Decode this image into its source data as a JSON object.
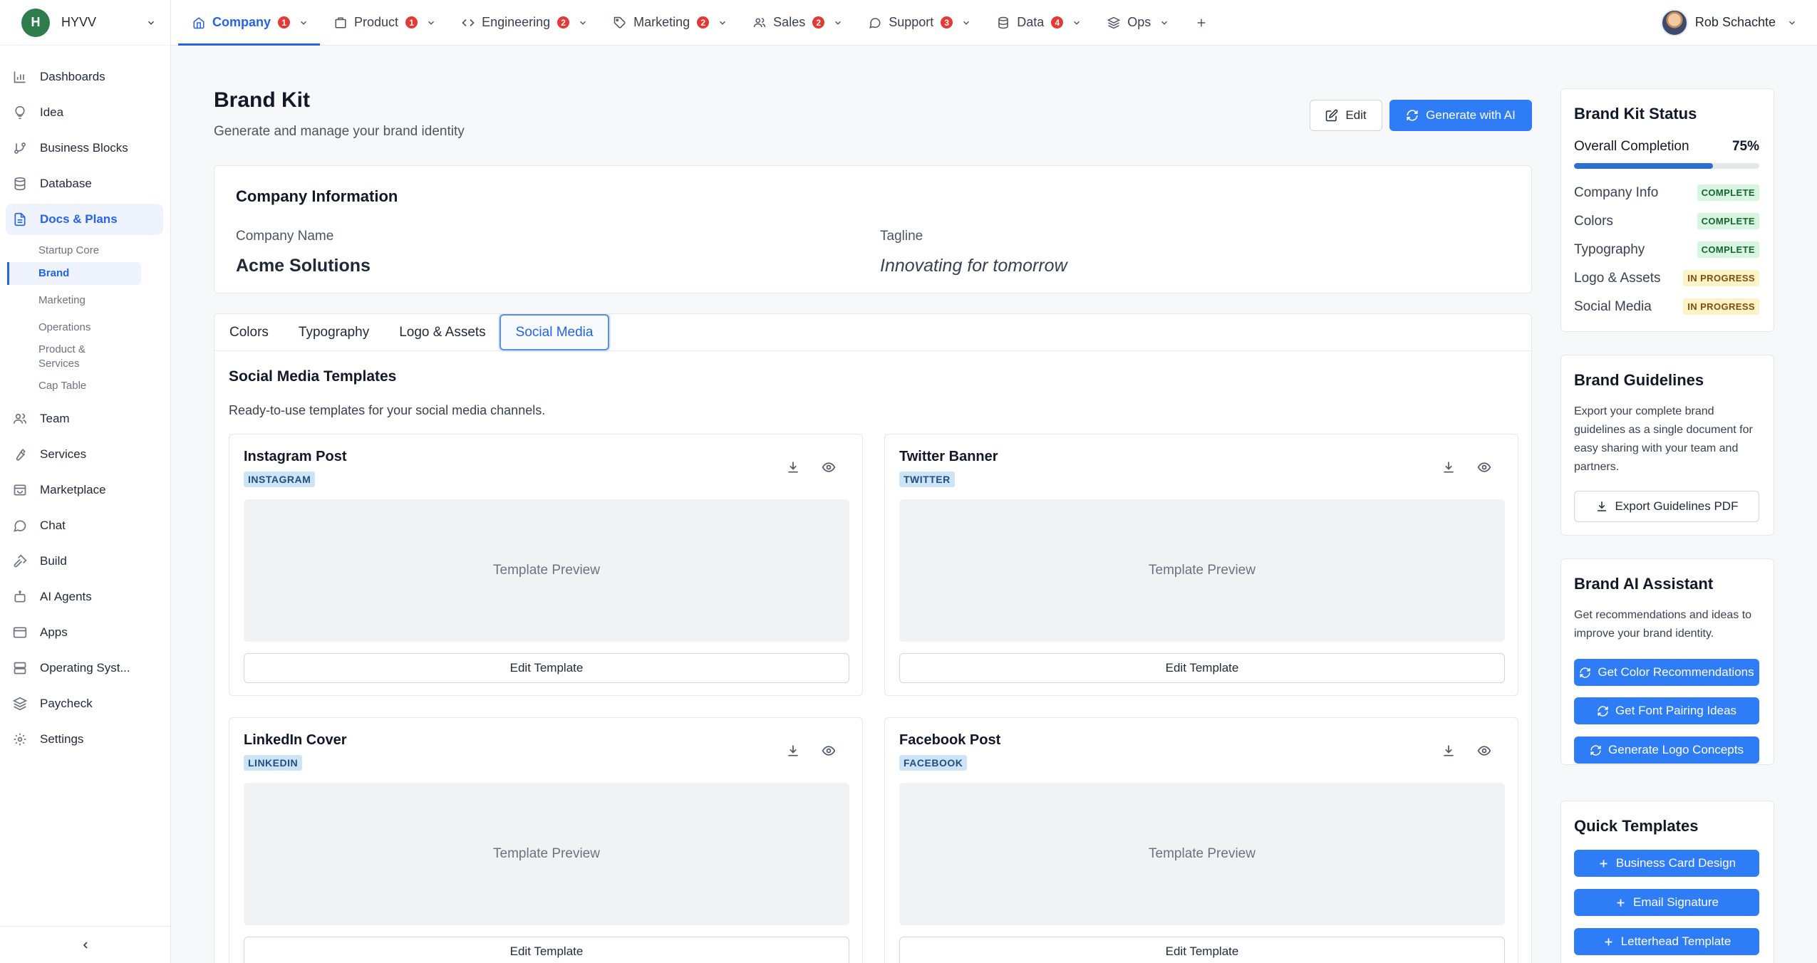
{
  "workspace": {
    "initial": "H",
    "name": "HYVV"
  },
  "sidebar": {
    "items": [
      {
        "label": "Dashboards",
        "icon": "bar-chart-icon"
      },
      {
        "label": "Idea",
        "icon": "lightbulb-icon"
      },
      {
        "label": "Business Blocks",
        "icon": "git-branch-icon"
      },
      {
        "label": "Database",
        "icon": "database-icon"
      },
      {
        "label": "Docs & Plans",
        "icon": "document-icon"
      },
      {
        "label": "Team",
        "icon": "users-icon"
      },
      {
        "label": "Services",
        "icon": "wrench-icon"
      },
      {
        "label": "Marketplace",
        "icon": "store-icon"
      },
      {
        "label": "Chat",
        "icon": "chat-icon"
      },
      {
        "label": "Build",
        "icon": "hammer-icon"
      },
      {
        "label": "AI Agents",
        "icon": "robot-icon"
      },
      {
        "label": "Apps",
        "icon": "window-icon"
      },
      {
        "label": "Operating Syst...",
        "icon": "server-icon"
      },
      {
        "label": "Paycheck",
        "icon": "layers-icon"
      },
      {
        "label": "Settings",
        "icon": "gear-icon"
      }
    ],
    "sub_items": [
      "Startup Core",
      "Brand",
      "Marketing",
      "Operations",
      "Product & Services",
      "Cap Table"
    ]
  },
  "topnav": {
    "tabs": [
      {
        "label": "Company",
        "badge": "1"
      },
      {
        "label": "Product",
        "badge": "1"
      },
      {
        "label": "Engineering",
        "badge": "2"
      },
      {
        "label": "Marketing",
        "badge": "2"
      },
      {
        "label": "Sales",
        "badge": "2"
      },
      {
        "label": "Support",
        "badge": "3"
      },
      {
        "label": "Data",
        "badge": "4"
      },
      {
        "label": "Ops",
        "badge": ""
      }
    ],
    "user_name": "Rob Schachte"
  },
  "page": {
    "title": "Brand Kit",
    "subtitle": "Generate and manage your brand identity",
    "edit_label": "Edit",
    "generate_label": "Generate with AI"
  },
  "company": {
    "heading": "Company Information",
    "name_label": "Company Name",
    "name_value": "Acme Solutions",
    "tagline_label": "Tagline",
    "tagline_value": "Innovating for tomorrow"
  },
  "brand_tabs": [
    "Colors",
    "Typography",
    "Logo & Assets",
    "Social Media"
  ],
  "social": {
    "title": "Social Media Templates",
    "subtitle": "Ready-to-use templates for your social media channels.",
    "templates": [
      {
        "title": "Instagram Post",
        "tag": "INSTAGRAM",
        "preview": "Template Preview",
        "button": "Edit Template"
      },
      {
        "title": "Twitter Banner",
        "tag": "TWITTER",
        "preview": "Template Preview",
        "button": "Edit Template"
      },
      {
        "title": "LinkedIn Cover",
        "tag": "LINKEDIN",
        "preview": "Template Preview",
        "button": "Edit Template"
      },
      {
        "title": "Facebook Post",
        "tag": "FACEBOOK",
        "preview": "Template Preview",
        "button": "Edit Template"
      }
    ]
  },
  "status": {
    "title": "Brand Kit Status",
    "overall_label": "Overall Completion",
    "overall_value": "75%",
    "overall_fraction": 0.75,
    "rows": [
      {
        "label": "Company Info",
        "status": "COMPLETE"
      },
      {
        "label": "Colors",
        "status": "COMPLETE"
      },
      {
        "label": "Typography",
        "status": "COMPLETE"
      },
      {
        "label": "Logo & Assets",
        "status": "IN PROGRESS"
      },
      {
        "label": "Social Media",
        "status": "IN PROGRESS"
      }
    ]
  },
  "guidelines": {
    "title": "Brand Guidelines",
    "text": "Export your complete brand guidelines as a single document for easy sharing with your team and partners.",
    "button": "Export Guidelines PDF"
  },
  "ai": {
    "title": "Brand AI Assistant",
    "text": "Get recommendations and ideas to improve your brand identity.",
    "buttons": [
      "Get Color Recommendations",
      "Get Font Pairing Ideas",
      "Generate Logo Concepts"
    ]
  },
  "quick": {
    "title": "Quick Templates",
    "buttons": [
      "Business Card Design",
      "Email Signature",
      "Letterhead Template"
    ]
  },
  "colors": {
    "accent": "#2f7df6",
    "workspace": "#2f7d4d",
    "badge": "#e53935"
  }
}
